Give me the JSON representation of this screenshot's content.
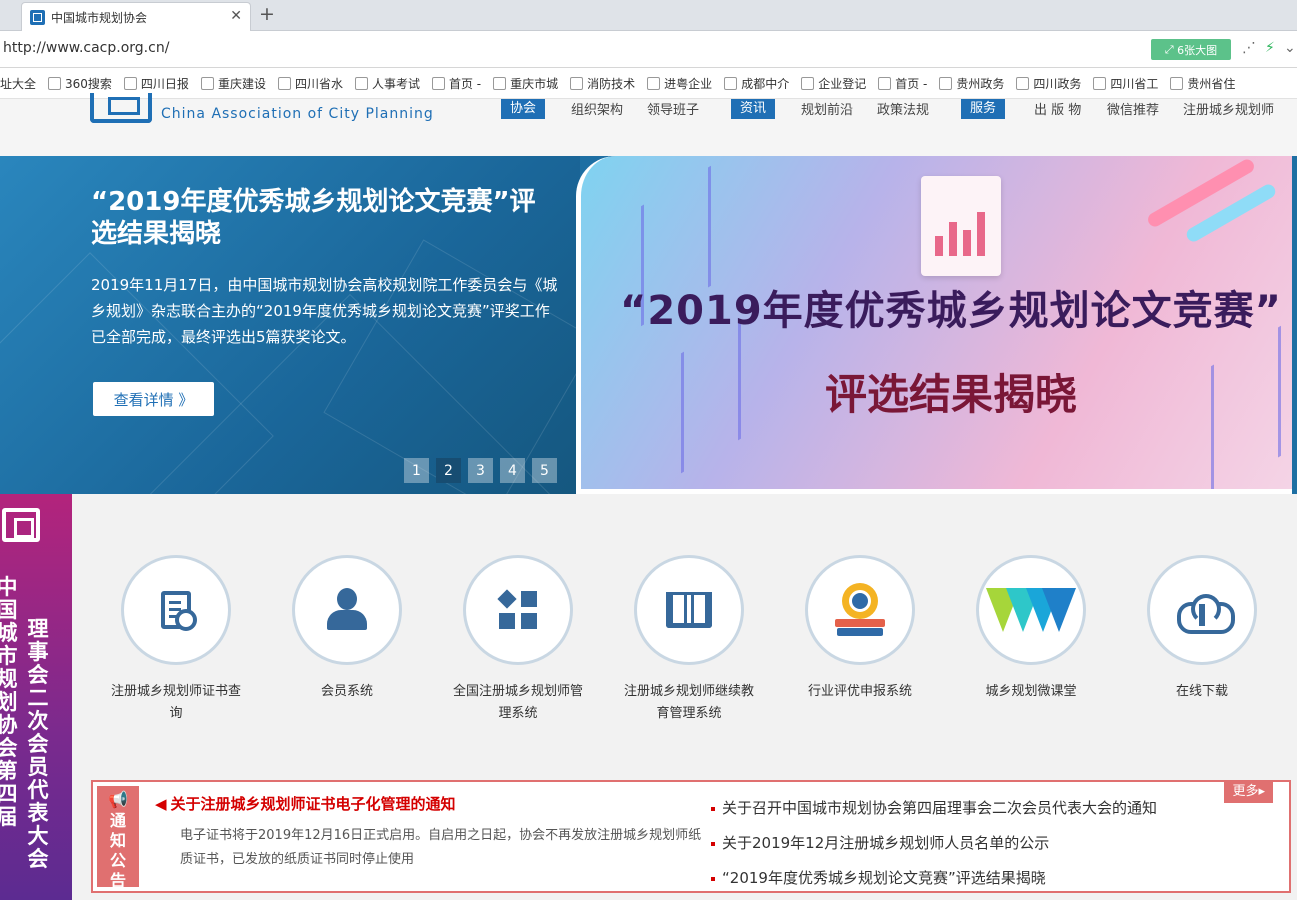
{
  "browser": {
    "tab_title": "中国城市规划协会",
    "url": "http://www.cacp.org.cn/",
    "big_image_label": "6张大图",
    "bookmarks": [
      "址大全",
      "360搜索",
      "四川日报",
      "重庆建设",
      "四川省水",
      "人事考试",
      "首页 -",
      "重庆市城",
      "消防技术",
      "进粤企业",
      "成都中介",
      "企业登记",
      "首页 -",
      "贵州政务",
      "四川政务",
      "四川省工",
      "贵州省住"
    ]
  },
  "header": {
    "org_en": "China Association of City Planning",
    "nav": [
      {
        "label": "协会",
        "badge": true
      },
      {
        "label": "组织架构",
        "badge": false
      },
      {
        "label": "领导班子",
        "badge": false
      },
      {
        "label": "资讯",
        "badge": true
      },
      {
        "label": "规划前沿",
        "badge": false
      },
      {
        "label": "政策法规",
        "badge": false
      },
      {
        "label": "服务",
        "badge": true
      },
      {
        "label": "出 版 物",
        "badge": false
      },
      {
        "label": "微信推荐",
        "badge": false
      },
      {
        "label": "注册城乡规划师",
        "badge": false
      }
    ]
  },
  "banner": {
    "title": "“2019年度优秀城乡规划论文竞赛”评选结果揭晓",
    "desc": "2019年11月17日，由中国城市规划协会高校规划院工作委员会与《城乡规划》杂志联合主办的“2019年度优秀城乡规划论文竞赛”评奖工作已全部完成，最终评选出5篇获奖论文。",
    "button": "查看详情 》",
    "image_title": "“2019年度优秀城乡规划论文竞赛”",
    "image_subtitle": "评选结果揭晓",
    "pages": [
      "1",
      "2",
      "3",
      "4",
      "5"
    ],
    "active_page": "2"
  },
  "ribbon": {
    "col1": "中国城市规划协会第四届",
    "col2": "理事会二次会员代表大会"
  },
  "services": [
    {
      "label": "注册城乡规划师证书查询",
      "icon": "certificate-icon"
    },
    {
      "label": "会员系统",
      "icon": "user-icon"
    },
    {
      "label": "全国注册城乡规划师管理系统",
      "icon": "grid-icon"
    },
    {
      "label": "注册城乡规划师继续教育管理系统",
      "icon": "book-icon"
    },
    {
      "label": "行业评优申报系统",
      "icon": "award-icon"
    },
    {
      "label": "城乡规划微课堂",
      "icon": "w-logo-icon"
    },
    {
      "label": "在线下载",
      "icon": "cloud-download-icon"
    }
  ],
  "notice": {
    "tag": "通知公告",
    "headline": "关于注册城乡规划师证书电子化管理的通知",
    "desc": "电子证书将于2019年12月16日正式启用。自启用之日起，协会不再发放注册城乡规划师纸质证书，已发放的纸质证书同时停止使用",
    "items": [
      "关于召开中国城市规划协会第四届理事会二次会员代表大会的通知",
      "关于2019年12月注册城乡规划师人员名单的公示",
      "“2019年度优秀城乡规划论文竞赛”评选结果揭晓"
    ],
    "more": "更多▸"
  },
  "colors": {
    "brand": "#1f6fb5",
    "notice_red": "#e07070",
    "headline_red": "#d40000"
  }
}
